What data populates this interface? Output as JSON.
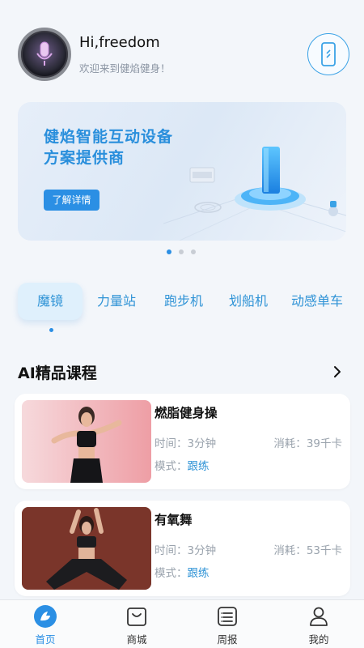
{
  "header": {
    "greeting": "Hi,freedom",
    "welcome": "欢迎来到健焰健身！"
  },
  "banner": {
    "title_line1": "健焰智能互动设备",
    "title_line2": "方案提供商",
    "button_label": "了解详情",
    "page_count": 3,
    "active_page": 1
  },
  "categories": {
    "items": [
      {
        "label": "魔镜"
      },
      {
        "label": "力量站"
      },
      {
        "label": "跑步机"
      },
      {
        "label": "划船机"
      },
      {
        "label": "动感单车"
      }
    ],
    "active_index": 0
  },
  "section": {
    "title": "AI精品课程"
  },
  "courses": [
    {
      "title": "燃脂健身操",
      "time_label": "时间：",
      "time": "3分钟",
      "cal_label": "消耗：",
      "calories": "39千卡",
      "mode_label": "模式：",
      "mode": "跟练"
    },
    {
      "title": "有氧舞",
      "time_label": "时间：",
      "time": "3分钟",
      "cal_label": "消耗：",
      "calories": "53千卡",
      "mode_label": "模式：",
      "mode": "跟练"
    }
  ],
  "tabbar": {
    "items": [
      {
        "label": "首页",
        "icon": "home-icon"
      },
      {
        "label": "商城",
        "icon": "shopping-bag-icon"
      },
      {
        "label": "周报",
        "icon": "report-icon"
      },
      {
        "label": "我的",
        "icon": "user-icon"
      }
    ],
    "active_index": 0
  },
  "colors": {
    "accent": "#2b8fe4",
    "category_text": "#2f93d6",
    "muted_text": "#9aa3ad"
  }
}
